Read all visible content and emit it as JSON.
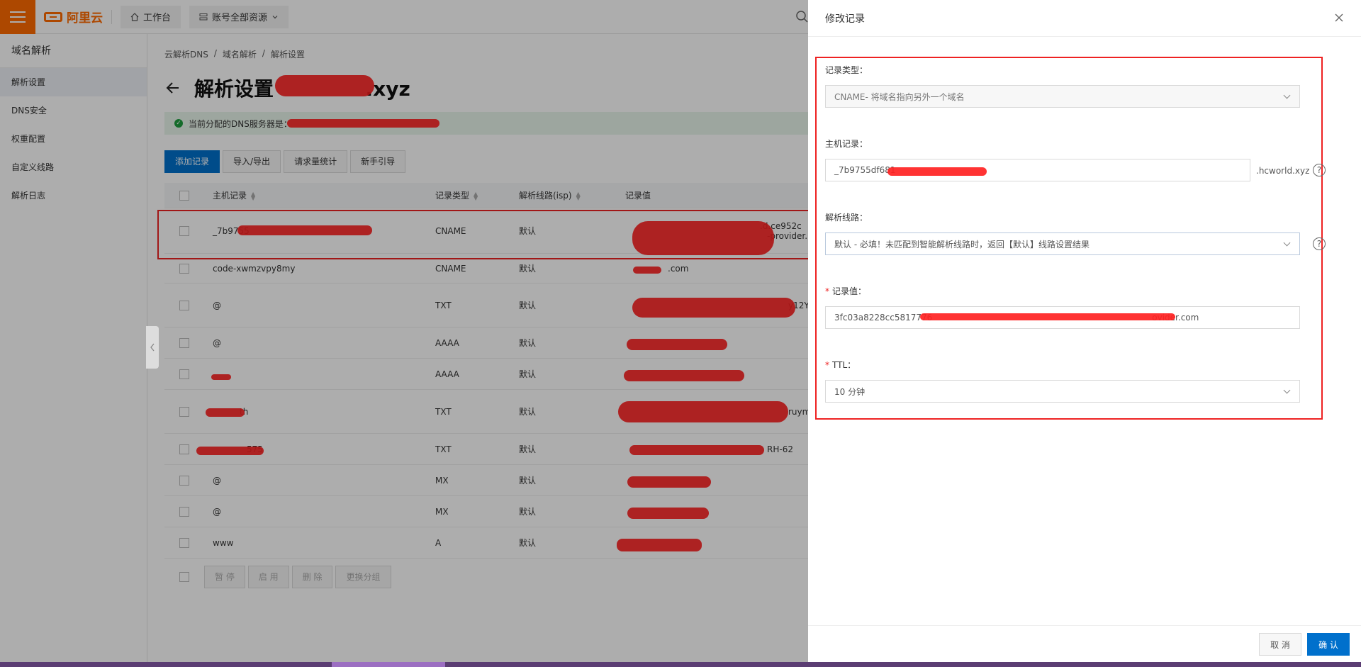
{
  "topbar": {
    "brand": "阿里云",
    "workbench": "工作台",
    "resource_scope": "账号全部资源"
  },
  "sidebar": {
    "title": "域名解析",
    "items": [
      {
        "label": "解析设置"
      },
      {
        "label": "DNS安全"
      },
      {
        "label": "权重配置"
      },
      {
        "label": "自定义线路"
      },
      {
        "label": "解析日志"
      }
    ]
  },
  "main": {
    "breadcrumb": [
      "云解析DNS",
      "域名解析",
      "解析设置"
    ],
    "title_prefix": "解析设置",
    "title_suffix": ".xyz",
    "notice": "当前分配的DNS服务器是：",
    "actions": [
      "添加记录",
      "导入/导出",
      "请求量统计",
      "新手引导"
    ],
    "table": {
      "headers": [
        "主机记录",
        "记录类型",
        "解析线路(isp)",
        "记录值"
      ],
      "rows": [
        {
          "host": "_7b9755",
          "type": "CNAME",
          "isp": "默认",
          "value": ".d.ce952c",
          "value2": "-provider."
        },
        {
          "host": "code-xwmzvpy8my",
          "type": "CNAME",
          "isp": "默认",
          "value": ".com",
          "value2": ""
        },
        {
          "host": "@",
          "type": "TXT",
          "isp": "默认",
          "value": "y12Y",
          "value2": ""
        },
        {
          "host": "@",
          "type": "AAAA",
          "isp": "默认",
          "value": "",
          "value2": ""
        },
        {
          "host": "",
          "type": "AAAA",
          "isp": "默认",
          "value": "",
          "value2": ""
        },
        {
          "host": "th",
          "type": "TXT",
          "isp": "默认",
          "value": "ruym",
          "value2": ""
        },
        {
          "host": "575",
          "type": "TXT",
          "isp": "默认",
          "value": "RH-62",
          "value2": ""
        },
        {
          "host": "@",
          "type": "MX",
          "isp": "默认",
          "value": "",
          "value2": ""
        },
        {
          "host": "@",
          "type": "MX",
          "isp": "默认",
          "value": "",
          "value2": ""
        },
        {
          "host": "www",
          "type": "A",
          "isp": "默认",
          "value": "",
          "value2": ""
        }
      ]
    },
    "bottom_actions": [
      "暂 停",
      "启 用",
      "删 除",
      "更换分组"
    ]
  },
  "drawer": {
    "title": "修改记录",
    "record_type_label": "记录类型：",
    "record_type_value": "CNAME- 将域名指向另外一个域名",
    "host_label": "主机记录：",
    "host_value": "_7b9755df681",
    "host_suffix": ".hcworld.xyz",
    "line_label": "解析线路：",
    "line_value": "默认 - 必填！未匹配到智能解析线路时，返回【默认】线路设置结果",
    "value_label": "记录值：",
    "value_value": "3fc03a8228cc5817776",
    "value_tail": "ovider.com",
    "ttl_label": "TTL：",
    "ttl_value": "10 分钟",
    "cancel": "取 消",
    "confirm": "确 认"
  },
  "colors": {
    "accent": "#ff6a00",
    "primary": "#0070cc",
    "annotation": "#e22222"
  }
}
